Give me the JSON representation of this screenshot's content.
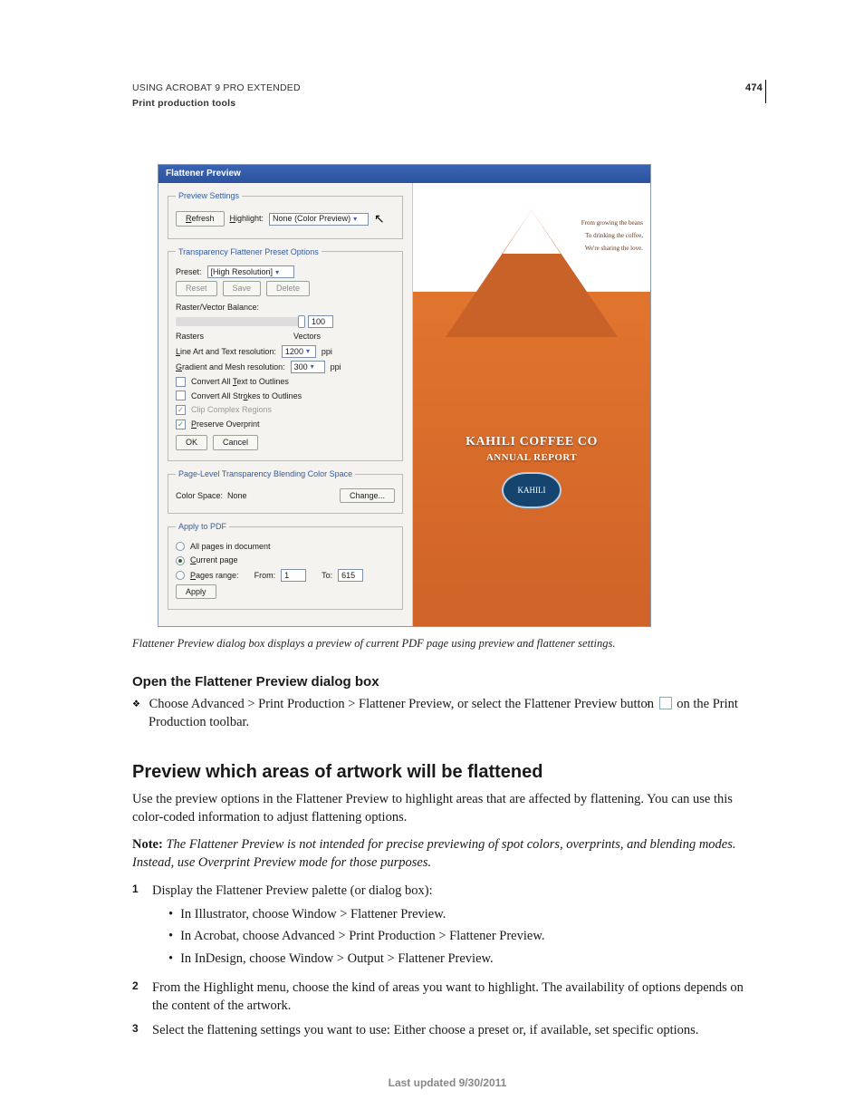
{
  "page": {
    "header_title": "USING ACROBAT 9 PRO EXTENDED",
    "header_section": "Print production tools",
    "page_number": "474",
    "last_updated": "Last updated 9/30/2011"
  },
  "dialog": {
    "title": "Flattener Preview",
    "preview_settings": {
      "legend": "Preview Settings",
      "refresh_label": "Refresh",
      "highlight_label": "Highlight:",
      "highlight_value": "None (Color Preview)"
    },
    "flattener_options": {
      "legend": "Transparency Flattener Preset Options",
      "preset_label": "Preset:",
      "preset_value": "[High Resolution]",
      "reset": "Reset",
      "save": "Save",
      "delete": "Delete",
      "balance_label": "Raster/Vector Balance:",
      "balance_value": "100",
      "rasters": "Rasters",
      "vectors": "Vectors",
      "lineart_label": "Line Art and Text resolution:",
      "lineart_value": "1200",
      "gradient_label": "Gradient and Mesh resolution:",
      "gradient_value": "300",
      "ppi": "ppi",
      "text_outlines": "Convert All Text to Outlines",
      "stroke_outlines": "Convert All Strokes to Outlines",
      "clip": "Clip Complex Regions",
      "preserve": "Preserve Overprint",
      "ok": "OK",
      "cancel": "Cancel"
    },
    "blend_space": {
      "legend": "Page-Level Transparency Blending Color Space",
      "colorspace_label": "Color Space:",
      "colorspace_value": "None",
      "change": "Change..."
    },
    "apply": {
      "legend": "Apply to PDF",
      "all_pages": "All pages in document",
      "current_page": "Current page",
      "pages_range": "Pages range:",
      "from_label": "From:",
      "from_value": "1",
      "to_label": "To:",
      "to_value": "615",
      "apply_btn": "Apply"
    },
    "preview_doc": {
      "tag1": "From growing the beans",
      "tag2": "To drinking the coffee,",
      "tag3": "We're sharing the love.",
      "title1": "KAHILI COFFEE CO",
      "title2": "ANNUAL REPORT",
      "logo": "KAHILI"
    }
  },
  "content": {
    "figure_caption": "Flattener Preview dialog box displays a preview of current PDF page using preview and flattener settings.",
    "h3_open": "Open the Flattener Preview dialog box",
    "open_item_pre": "Choose Advanced > Print Production > Flattener Preview, or select the Flattener Preview button ",
    "open_item_post": " on the Print Production toolbar.",
    "h2_preview": "Preview which areas of artwork will be flattened",
    "para1": "Use the preview options in the Flattener Preview to highlight areas that are affected by flattening. You can use this color-coded information to adjust flattening options.",
    "note_label": "Note:",
    "note_text": " The Flattener Preview is not intended for precise previewing of spot colors, overprints, and blending modes. Instead, use Overprint Preview mode for those purposes.",
    "step1": "Display the Flattener Preview palette (or dialog box):",
    "bul_a": "In Illustrator, choose Window > Flattener Preview.",
    "bul_b": "In Acrobat, choose Advanced > Print Production > Flattener Preview.",
    "bul_c": "In InDesign, choose Window > Output > Flattener Preview.",
    "step2": "From the Highlight menu, choose the kind of areas you want to highlight. The availability of options depends on the content of the artwork.",
    "step3": "Select the flattening settings you want to use: Either choose a preset or, if available, set specific options."
  }
}
